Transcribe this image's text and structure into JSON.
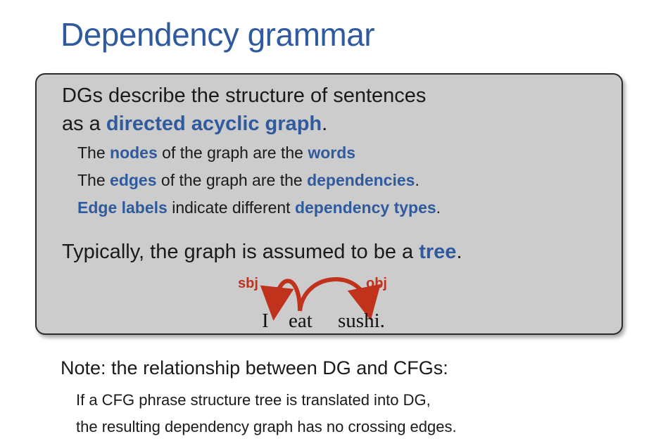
{
  "slide": {
    "title": "Dependency grammar",
    "box": {
      "line1": "DGs describe the structure of sentences",
      "line2_prefix": "as a ",
      "line2_highlight": "directed acyclic graph",
      "line2_suffix": ".",
      "sub1": {
        "a": "The ",
        "b": "nodes",
        "c": " of the graph are the ",
        "d": "words"
      },
      "sub2": {
        "a": "The ",
        "b": "edges",
        "c": " of the graph are the ",
        "d": "dependencies",
        "e": "."
      },
      "sub3": {
        "a": "Edge labels",
        "b": " indicate different ",
        "c": "dependency types",
        "d": "."
      },
      "line3_prefix": "Typically, the graph is assumed to be a ",
      "line3_highlight": "tree",
      "line3_suffix": "."
    },
    "diagram": {
      "words": [
        "I",
        "eat",
        "sushi."
      ],
      "labels": [
        "sbj",
        "obj"
      ],
      "arc_color": "#c0321c"
    },
    "note": {
      "heading": "Note: the relationship between DG and CFGs:",
      "line1": "If a CFG phrase structure tree is translated into DG,",
      "line2": "the resulting dependency graph has no crossing edges."
    },
    "colors": {
      "accent": "#2f5a9e",
      "box_bg": "#cccccc"
    }
  }
}
